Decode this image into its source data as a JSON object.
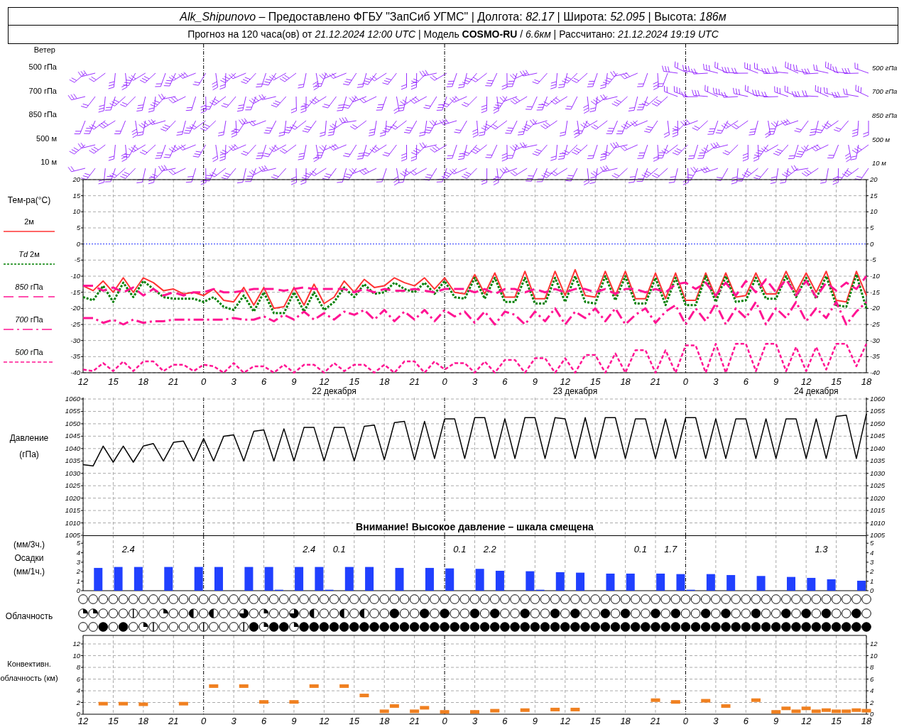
{
  "header": {
    "line_1": "*Alk_Shipunovo* – Предоставлено ФГБУ \"ЗапСиб УГМС\" | Долгота: *82.17* | Широта: *52.095* | Высота: *186м*",
    "line_2": "Прогноз на 120 часа(ов) от *21.12.2024 12:00 UTC*  | Модель **COSMO-RU** / *6.6км* | Рассчитано: *21.12.2024 19:19 UTC*"
  },
  "wind": {
    "title": "Ветер",
    "levels_left": [
      "500 гПа",
      "700 гПа",
      "850 гПа",
      "500 м",
      "10  м"
    ],
    "levels_right": [
      "500 гПа",
      "700 гПа",
      "850 гПа",
      "500 м",
      "10  м"
    ]
  },
  "temperature": {
    "chart_data": {
      "type": "line",
      "ylabel": "Тем-ра(°C)",
      "categories": [
        "12",
        null,
        null,
        "15",
        null,
        null,
        "18",
        null,
        null,
        "21",
        null,
        null,
        "0",
        null,
        null,
        "3",
        null,
        null,
        "6",
        null,
        null,
        "9",
        null,
        null,
        "12",
        null,
        null,
        "15",
        null,
        null,
        "18",
        null,
        null,
        "21",
        null,
        null,
        "0",
        null,
        null,
        "3",
        null,
        null,
        "6",
        null,
        null,
        "9",
        null,
        null,
        "12",
        null,
        null,
        "15",
        null,
        null,
        "18",
        null,
        null,
        "21",
        null,
        null,
        "0",
        null,
        null,
        "3",
        null,
        null,
        "6",
        null,
        null,
        "9",
        null,
        null,
        "12",
        null,
        null,
        "15",
        null,
        null,
        "18"
      ],
      "grid": true,
      "ref_lines": [
        {
          "axis": "y",
          "value": 0,
          "color": "#2030ff"
        }
      ],
      "ylim": [
        -40,
        20
      ],
      "yticks": [
        -40,
        -35,
        -30,
        -25,
        -20,
        -15,
        -10,
        -5,
        0,
        5,
        10,
        15,
        20
      ],
      "series": [
        {
          "name": "2м",
          "color": "#ff3333",
          "line_style": "solid",
          "values": [
            -13,
            -14.5,
            -11.5,
            -15,
            -10.5,
            -15,
            -10.5,
            -12,
            -14.5,
            -14,
            -15.5,
            -15,
            -16,
            -14,
            -17.5,
            -18,
            -13.5,
            -19,
            -13.5,
            -20,
            -19.5,
            -13.5,
            -19,
            -12.5,
            -18.5,
            -16.5,
            -11.5,
            -15,
            -11,
            -13.5,
            -13,
            -10.5,
            -12,
            -13,
            -10.5,
            -14,
            -10.5,
            -15,
            -15.5,
            -9.5,
            -15.5,
            -9,
            -16.5,
            -16.5,
            -8.5,
            -17,
            -17,
            -8.5,
            -16,
            -8,
            -16,
            -16.5,
            -8.5,
            -16,
            -8.5,
            -17,
            -17,
            -9,
            -17,
            -9,
            -17.5,
            -17.5,
            -9,
            -16.5,
            -9,
            -16.5,
            -16,
            -9,
            -15.5,
            -15.5,
            -8.5,
            -15,
            -9,
            -15,
            -8.5,
            -17.5,
            -18,
            -8.5,
            -16
          ]
        },
        {
          "name": "*Td*  2м",
          "color": "#008000",
          "line_style": "dotted",
          "values": [
            -16.5,
            -17.5,
            -13,
            -18,
            -12,
            -16.5,
            -11.5,
            -14,
            -16.5,
            -17,
            -17,
            -17,
            -18,
            -16.5,
            -19.5,
            -20.5,
            -16,
            -21,
            -15,
            -21.5,
            -21.5,
            -15,
            -21,
            -15,
            -20.5,
            -18,
            -13.5,
            -16.5,
            -12.5,
            -15.5,
            -15,
            -12,
            -14,
            -15,
            -12,
            -15.5,
            -11.5,
            -16.5,
            -17,
            -10.5,
            -17,
            -10.5,
            -18,
            -18,
            -10.5,
            -18.5,
            -18.5,
            -10.5,
            -18,
            -10,
            -18,
            -18.5,
            -10,
            -17.5,
            -10,
            -18.5,
            -18.5,
            -10.5,
            -19,
            -10.5,
            -19,
            -19,
            -10,
            -18,
            -10,
            -18,
            -17.5,
            -10.5,
            -17,
            -17,
            -10,
            -16.5,
            -10.5,
            -17,
            -10,
            -19,
            -19.5,
            -9.5,
            -20
          ]
        },
        {
          "name": "*850* гПа",
          "color": "#ff1493",
          "line_style": "long-dashed",
          "values": [
            -13,
            -13,
            -14.5,
            -13.5,
            -15,
            -13.5,
            -16,
            -14,
            -16,
            -15,
            -16,
            -15,
            -15,
            -14,
            -15,
            -15,
            -14.5,
            -14,
            -14,
            -14,
            -14.5,
            -14,
            -13.5,
            -14,
            -14,
            -14,
            -14,
            -15,
            -14,
            -15,
            -14,
            -14.5,
            -14.5,
            -14,
            -14.5,
            -15,
            -14,
            -14,
            -14,
            -15,
            -14,
            -15.5,
            -14,
            -14,
            -15,
            -14,
            -15,
            -14,
            -15,
            -14,
            -14,
            -15,
            -14,
            -15.5,
            -14,
            -14,
            -15,
            -14,
            -15,
            -12.5,
            -12,
            -14,
            -12,
            -16,
            -12,
            -16,
            -11.5,
            -15,
            -11,
            -15,
            -11,
            -16,
            -11.5,
            -16.5,
            -12,
            -14.5,
            -12,
            -14,
            -10
          ]
        },
        {
          "name": "*700* гПа",
          "color": "#ff1493",
          "line_style": "dashdot",
          "values": [
            -23,
            -23,
            -24.5,
            -23.5,
            -25,
            -23.5,
            -24.5,
            -24,
            -24,
            -23.5,
            -23.5,
            -23.5,
            -23.5,
            -23.5,
            -23.5,
            -23,
            -23.5,
            -23.5,
            -22.5,
            -24,
            -22,
            -23.5,
            -21,
            -23.5,
            -21.5,
            -23.5,
            -21,
            -22,
            -20.5,
            -23.5,
            -20.5,
            -24,
            -21,
            -23.5,
            -20.5,
            -24,
            -20.5,
            -22.5,
            -21,
            -24.5,
            -21,
            -25,
            -21,
            -22,
            -25,
            -21,
            -24,
            -20,
            -25,
            -21,
            -23,
            -20,
            -24,
            -20,
            -25,
            -22,
            -20,
            -24.5,
            -21,
            -19,
            -25,
            -20,
            -24,
            -18.5,
            -25,
            -20,
            -23,
            -18,
            -25,
            -20,
            -23,
            -18,
            -24,
            -20,
            -23,
            -18,
            -25,
            -21,
            -18
          ]
        },
        {
          "name": "*500* гПа",
          "color": "#ff1493",
          "line_style": "dashed",
          "values": [
            -39,
            -39.5,
            -37,
            -39.5,
            -36.5,
            -39.5,
            -36.5,
            -36.5,
            -39.5,
            -37.5,
            -37.5,
            -39.5,
            -37.5,
            -38,
            -40,
            -37,
            -40,
            -38,
            -38,
            -40,
            -37.5,
            -40,
            -37.5,
            -37.5,
            -40,
            -37,
            -39.5,
            -37.5,
            -37.5,
            -40,
            -37.5,
            -40,
            -36.5,
            -36.5,
            -40,
            -36.5,
            -39,
            -37,
            -37,
            -40,
            -36.5,
            -40,
            -36,
            -36,
            -40,
            -35.5,
            -35.5,
            -40,
            -35.5,
            -40,
            -34.5,
            -34.5,
            -40,
            -34,
            -40,
            -33,
            -33,
            -40,
            -33,
            -40,
            -31.5,
            -31.5,
            -40,
            -31,
            -40,
            -31,
            -31,
            -39.5,
            -31,
            -31,
            -39.5,
            -32,
            -39.5,
            -32,
            -39,
            -31,
            -31,
            -38,
            -31
          ]
        }
      ]
    },
    "right_ticks": [
      "20",
      "15",
      "10",
      "5",
      "0",
      "-5",
      "-10",
      "-15",
      "-20",
      "-25",
      "-30",
      "-35",
      "-40"
    ],
    "day_labels": [
      "22 декабря",
      "23 декабря",
      "24 декабря"
    ]
  },
  "pressure": {
    "chart_data": {
      "type": "line",
      "ylabel": "Давление (гПа)",
      "grid": true,
      "categories": [
        null,
        null,
        null,
        null,
        null,
        null,
        null,
        null,
        null,
        null,
        null,
        null,
        null,
        null,
        null,
        null,
        null,
        null,
        null,
        null,
        null,
        null,
        null,
        null,
        null,
        null,
        null,
        null,
        null,
        null,
        null,
        null,
        null,
        null,
        null,
        null,
        null,
        null,
        null,
        null,
        null,
        null,
        null,
        null,
        null,
        null,
        null,
        null,
        null,
        null,
        null,
        null,
        null,
        null,
        null,
        null,
        null,
        null,
        null,
        null,
        null,
        null,
        null,
        null,
        null,
        null,
        null,
        null,
        null,
        null,
        null,
        null,
        null,
        null,
        null,
        null,
        null,
        null,
        null
      ],
      "ylim": [
        1005,
        1060
      ],
      "yticks": [
        1005,
        1010,
        1015,
        1020,
        1025,
        1030,
        1035,
        1040,
        1045,
        1050,
        1055,
        1060
      ],
      "series": [
        {
          "color": "#000000",
          "values": [
            1033.5,
            1033,
            1041,
            1034.5,
            1041,
            1034.5,
            1041,
            1042,
            1035,
            1042.5,
            1043,
            1035,
            1044,
            1035,
            1045,
            1045.5,
            1035,
            1047,
            1047.5,
            1035,
            1048,
            1035,
            1048.5,
            1048.5,
            1035,
            1048.5,
            1048.5,
            1035,
            1049,
            1049.5,
            1035.5,
            1050.5,
            1051,
            1035.5,
            1051,
            1036,
            1052,
            1052,
            1036,
            1052.5,
            1052.5,
            1036,
            1052,
            1036,
            1052.5,
            1052.5,
            1036,
            1052.5,
            1052,
            1036,
            1052.5,
            1036,
            1052.5,
            1052.5,
            1036,
            1052,
            1052,
            1036,
            1052,
            1036,
            1052.5,
            1052.5,
            1036,
            1052,
            1036,
            1052,
            1052,
            1036,
            1052,
            1036,
            1052,
            1052,
            1036,
            1052,
            1036,
            1053,
            1053.5,
            1036,
            1054
          ]
        }
      ]
    },
    "right_ticks": [
      "1060",
      "1055",
      "1050",
      "1045",
      "1040",
      "1035",
      "1030",
      "1025",
      "1020",
      "1015",
      "1010",
      "1005"
    ],
    "warning": "Внимание! Высокое давление – шкала смещена"
  },
  "precipitation": {
    "unit_top": "(мм/3ч.)",
    "title": "Осадки",
    "unit_bottom": "(мм/1ч.)",
    "chart_data": {
      "type": "bar",
      "categories": [
        null,
        null,
        null,
        null,
        null,
        null,
        null,
        null,
        null,
        null,
        null,
        null,
        null,
        null,
        null,
        null,
        null,
        null,
        null,
        null,
        null,
        null,
        null,
        null,
        null,
        null,
        null,
        null,
        null,
        null,
        null,
        null,
        null,
        null,
        null,
        null,
        null,
        null,
        null,
        null,
        null,
        null,
        null,
        null,
        null,
        null,
        null,
        null,
        null,
        null,
        null,
        null,
        null,
        null,
        null,
        null,
        null,
        null,
        null,
        null,
        null,
        null,
        null,
        null,
        null,
        null,
        null,
        null,
        null,
        null,
        null,
        null,
        null,
        null,
        null,
        null,
        null,
        null,
        null
      ],
      "grid": "x",
      "ylim": [
        0,
        5.8
      ],
      "yticks": [
        0,
        1,
        2,
        3,
        4,
        5
      ],
      "series": [
        {
          "color": "#2040ff",
          "values": [
            0,
            0,
            2.4,
            0,
            2.5,
            0,
            2.5,
            0,
            0,
            2.5,
            0,
            0,
            2.5,
            0,
            2.5,
            0,
            0,
            2.5,
            0,
            2.5,
            0.1,
            0,
            2.5,
            0,
            2.5,
            0.1,
            0,
            2.5,
            0,
            2.5,
            0,
            0,
            2.4,
            0,
            0,
            2.4,
            0,
            2.35,
            0,
            0,
            2.3,
            0,
            2.1,
            0,
            0,
            2.05,
            0.1,
            0,
            1.95,
            0,
            1.9,
            0,
            0,
            1.8,
            0,
            1.8,
            0,
            0,
            1.8,
            0,
            1.75,
            0.1,
            0,
            1.75,
            0,
            1.65,
            0,
            0,
            1.55,
            0,
            0,
            1.45,
            0,
            1.35,
            0,
            1.2,
            0,
            0,
            1.05
          ]
        }
      ],
      "value_labels": [
        null,
        null,
        null,
        null,
        null,
        "2.4",
        null,
        null,
        null,
        null,
        null,
        null,
        null,
        null,
        null,
        null,
        null,
        null,
        null,
        null,
        null,
        null,
        null,
        "2.4",
        null,
        null,
        "0.1",
        null,
        null,
        null,
        null,
        null,
        null,
        null,
        null,
        null,
        null,
        null,
        "0.1",
        null,
        null,
        "2.2",
        null,
        null,
        null,
        null,
        null,
        null,
        null,
        null,
        null,
        null,
        null,
        null,
        null,
        null,
        "0.1",
        null,
        null,
        "1.7",
        null,
        null,
        null,
        null,
        null,
        null,
        null,
        null,
        null,
        null,
        null,
        null,
        null,
        null,
        "1.3",
        null,
        null,
        null,
        null
      ]
    },
    "right_ticks": [
      "5",
      "4",
      "3",
      "2",
      "1",
      "0"
    ]
  },
  "cloudiness": {
    "title": "Облачность",
    "rows": [
      {
        "cells": [
          {
            "kind": "clear"
          },
          {
            "kind": "clear"
          },
          {
            "kind": "clear"
          },
          {
            "kind": "clear"
          },
          {
            "kind": "clear"
          },
          {
            "kind": "clear"
          },
          {
            "kind": "clear"
          },
          {
            "kind": "clear"
          },
          {
            "kind": "clear"
          },
          {
            "kind": "clear"
          },
          {
            "kind": "clear"
          },
          {
            "kind": "clear"
          },
          {
            "kind": "clear"
          },
          {
            "kind": "clear"
          },
          {
            "kind": "clear"
          },
          {
            "kind": "clear"
          },
          {
            "kind": "clear"
          },
          {
            "kind": "clear"
          },
          {
            "kind": "clear"
          },
          {
            "kind": "clear"
          },
          {
            "kind": "clear"
          },
          {
            "kind": "clear"
          },
          {
            "kind": "clear"
          },
          {
            "kind": "clear"
          },
          {
            "kind": "clear"
          },
          {
            "kind": "clear"
          },
          {
            "kind": "clear"
          },
          {
            "kind": "clear"
          },
          {
            "kind": "clear"
          },
          {
            "kind": "clear"
          },
          {
            "kind": "clear"
          },
          {
            "kind": "clear"
          },
          {
            "kind": "clear"
          },
          {
            "kind": "clear"
          },
          {
            "kind": "clear"
          },
          {
            "kind": "clear"
          },
          {
            "kind": "clear"
          },
          {
            "kind": "clear"
          },
          {
            "kind": "clear"
          },
          {
            "kind": "clear"
          },
          {
            "kind": "clear"
          },
          {
            "kind": "clear"
          },
          {
            "kind": "clear"
          },
          {
            "kind": "clear"
          },
          {
            "kind": "clear"
          },
          {
            "kind": "clear"
          },
          {
            "kind": "clear"
          },
          {
            "kind": "clear"
          },
          {
            "kind": "clear"
          },
          {
            "kind": "clear"
          },
          {
            "kind": "clear"
          },
          {
            "kind": "clear"
          },
          {
            "kind": "clear"
          },
          {
            "kind": "clear"
          },
          {
            "kind": "clear"
          },
          {
            "kind": "clear"
          },
          {
            "kind": "clear"
          },
          {
            "kind": "clear"
          },
          {
            "kind": "clear"
          },
          {
            "kind": "clear"
          },
          {
            "kind": "clear"
          },
          {
            "kind": "clear"
          },
          {
            "kind": "clear"
          },
          {
            "kind": "clear"
          },
          {
            "kind": "clear"
          },
          {
            "kind": "clear"
          },
          {
            "kind": "clear"
          },
          {
            "kind": "clear"
          },
          {
            "kind": "clear"
          },
          {
            "kind": "clear"
          },
          {
            "kind": "clear"
          },
          {
            "kind": "clear"
          },
          {
            "kind": "clear"
          },
          {
            "kind": "clear"
          },
          {
            "kind": "clear"
          },
          {
            "kind": "clear"
          },
          {
            "kind": "clear"
          },
          {
            "kind": "clear"
          },
          {
            "kind": "clear"
          }
        ]
      },
      {
        "cells": [
          {
            "kind": "quarter"
          },
          {
            "kind": "quarter"
          },
          {
            "kind": "clear"
          },
          {
            "kind": "clear"
          },
          {
            "kind": "clear"
          },
          {
            "kind": "line"
          },
          {
            "kind": "clear"
          },
          {
            "kind": "clear"
          },
          {
            "kind": "quarter"
          },
          {
            "kind": "clear"
          },
          {
            "kind": "clear"
          },
          {
            "kind": "half"
          },
          {
            "kind": "clear"
          },
          {
            "kind": "half"
          },
          {
            "kind": "clear"
          },
          {
            "kind": "clear"
          },
          {
            "kind": "three-quarters"
          },
          {
            "kind": "clear"
          },
          {
            "kind": "quarter"
          },
          {
            "kind": "clear"
          },
          {
            "kind": "clear"
          },
          {
            "kind": "three-quarters"
          },
          {
            "kind": "clear"
          },
          {
            "kind": "half"
          },
          {
            "kind": "clear"
          },
          {
            "kind": "clear"
          },
          {
            "kind": "half"
          },
          {
            "kind": "clear"
          },
          {
            "kind": "half"
          },
          {
            "kind": "clear"
          },
          {
            "kind": "clear"
          },
          {
            "kind": "overcast"
          },
          {
            "kind": "clear"
          },
          {
            "kind": "clear"
          },
          {
            "kind": "overcast"
          },
          {
            "kind": "clear"
          },
          {
            "kind": "overcast"
          },
          {
            "kind": "clear"
          },
          {
            "kind": "clear"
          },
          {
            "kind": "overcast"
          },
          {
            "kind": "clear"
          },
          {
            "kind": "overcast"
          },
          {
            "kind": "clear"
          },
          {
            "kind": "clear"
          },
          {
            "kind": "overcast"
          },
          {
            "kind": "clear"
          },
          {
            "kind": "clear"
          },
          {
            "kind": "overcast"
          },
          {
            "kind": "clear"
          },
          {
            "kind": "overcast"
          },
          {
            "kind": "clear"
          },
          {
            "kind": "clear"
          },
          {
            "kind": "overcast"
          },
          {
            "kind": "clear"
          },
          {
            "kind": "overcast"
          },
          {
            "kind": "clear"
          },
          {
            "kind": "clear"
          },
          {
            "kind": "overcast"
          },
          {
            "kind": "clear"
          },
          {
            "kind": "overcast"
          },
          {
            "kind": "clear"
          },
          {
            "kind": "clear"
          },
          {
            "kind": "overcast"
          },
          {
            "kind": "clear"
          },
          {
            "kind": "overcast"
          },
          {
            "kind": "clear"
          },
          {
            "kind": "clear"
          },
          {
            "kind": "overcast"
          },
          {
            "kind": "clear"
          },
          {
            "kind": "clear"
          },
          {
            "kind": "overcast"
          },
          {
            "kind": "clear"
          },
          {
            "kind": "overcast"
          },
          {
            "kind": "clear"
          },
          {
            "kind": "overcast"
          },
          {
            "kind": "clear"
          },
          {
            "kind": "clear"
          },
          {
            "kind": "overcast"
          },
          {
            "kind": "clear"
          }
        ]
      },
      {
        "cells": [
          {
            "kind": "clear"
          },
          {
            "kind": "clear"
          },
          {
            "kind": "overcast"
          },
          {
            "kind": "clear"
          },
          {
            "kind": "overcast"
          },
          {
            "kind": "clear"
          },
          {
            "kind": "quarter"
          },
          {
            "kind": "line"
          },
          {
            "kind": "clear"
          },
          {
            "kind": "clear"
          },
          {
            "kind": "clear"
          },
          {
            "kind": "clear"
          },
          {
            "kind": "line"
          },
          {
            "kind": "clear"
          },
          {
            "kind": "clear"
          },
          {
            "kind": "clear"
          },
          {
            "kind": "line"
          },
          {
            "kind": "overcast"
          },
          {
            "kind": "quarter"
          },
          {
            "kind": "overcast"
          },
          {
            "kind": "overcast"
          },
          {
            "kind": "quarter"
          },
          {
            "kind": "overcast"
          },
          {
            "kind": "overcast"
          },
          {
            "kind": "overcast"
          },
          {
            "kind": "overcast"
          },
          {
            "kind": "overcast"
          },
          {
            "kind": "overcast"
          },
          {
            "kind": "overcast"
          },
          {
            "kind": "overcast"
          },
          {
            "kind": "overcast"
          },
          {
            "kind": "overcast"
          },
          {
            "kind": "overcast"
          },
          {
            "kind": "overcast"
          },
          {
            "kind": "overcast"
          },
          {
            "kind": "overcast"
          },
          {
            "kind": "overcast"
          },
          {
            "kind": "overcast"
          },
          {
            "kind": "overcast"
          },
          {
            "kind": "overcast"
          },
          {
            "kind": "overcast"
          },
          {
            "kind": "overcast"
          },
          {
            "kind": "overcast"
          },
          {
            "kind": "overcast"
          },
          {
            "kind": "overcast"
          },
          {
            "kind": "overcast"
          },
          {
            "kind": "overcast"
          },
          {
            "kind": "overcast"
          },
          {
            "kind": "overcast"
          },
          {
            "kind": "overcast"
          },
          {
            "kind": "overcast"
          },
          {
            "kind": "overcast"
          },
          {
            "kind": "overcast"
          },
          {
            "kind": "overcast"
          },
          {
            "kind": "overcast"
          },
          {
            "kind": "overcast"
          },
          {
            "kind": "overcast"
          },
          {
            "kind": "overcast"
          },
          {
            "kind": "overcast"
          },
          {
            "kind": "overcast"
          },
          {
            "kind": "overcast"
          },
          {
            "kind": "overcast"
          },
          {
            "kind": "overcast"
          },
          {
            "kind": "overcast"
          },
          {
            "kind": "overcast"
          },
          {
            "kind": "overcast"
          },
          {
            "kind": "overcast"
          },
          {
            "kind": "overcast"
          },
          {
            "kind": "overcast"
          },
          {
            "kind": "overcast"
          },
          {
            "kind": "overcast"
          },
          {
            "kind": "overcast"
          },
          {
            "kind": "overcast"
          },
          {
            "kind": "overcast"
          },
          {
            "kind": "overcast"
          },
          {
            "kind": "overcast"
          },
          {
            "kind": "overcast"
          },
          {
            "kind": "overcast"
          },
          {
            "kind": "overcast"
          }
        ]
      }
    ]
  },
  "convective": {
    "chart_data": {
      "type": "scatter",
      "ylabel": "Конвективн. облачность (км)",
      "categories": [
        "12",
        null,
        null,
        "15",
        null,
        null,
        "18",
        null,
        null,
        "21",
        null,
        null,
        "0",
        null,
        null,
        "3",
        null,
        null,
        "6",
        null,
        null,
        "9",
        null,
        null,
        "12",
        null,
        null,
        "15",
        null,
        null,
        "18",
        null,
        null,
        "21",
        null,
        null,
        "0",
        null,
        null,
        "3",
        null,
        null,
        "6",
        null,
        null,
        "9",
        null,
        null,
        "12",
        null,
        null,
        "15",
        null,
        null,
        "18",
        null,
        null,
        "21",
        null,
        null,
        "0",
        null,
        null,
        "3",
        null,
        null,
        "6",
        null,
        null,
        "9",
        null,
        null,
        "12",
        null,
        null,
        "15",
        null,
        null,
        "18"
      ],
      "grid": true,
      "ylim": [
        0,
        12
      ],
      "yticks": [
        0,
        2,
        4,
        6,
        8,
        10,
        12
      ],
      "series": [
        {
          "color": "#f08020",
          "values": [
            null,
            null,
            1.8,
            null,
            1.8,
            null,
            1.7,
            null,
            null,
            null,
            1.8,
            null,
            null,
            4.8,
            null,
            null,
            4.8,
            null,
            2.1,
            null,
            null,
            2.1,
            null,
            4.8,
            null,
            null,
            4.8,
            null,
            3.2,
            null,
            0.5,
            1.4,
            null,
            0.5,
            1.1,
            null,
            0.4,
            null,
            null,
            0.4,
            null,
            0.6,
            null,
            null,
            0.7,
            null,
            null,
            0.8,
            null,
            0.8,
            null,
            null,
            null,
            null,
            null,
            null,
            null,
            2.4,
            null,
            2.1,
            null,
            null,
            2.3,
            null,
            1.4,
            null,
            null,
            2.4,
            null,
            0.4,
            1.0,
            0.5,
            1.0,
            0.5,
            0.7,
            0.5,
            0.5,
            0.7,
            0.6
          ]
        }
      ]
    },
    "right_ticks": [
      "12",
      "10",
      "8",
      "6",
      "4",
      "2",
      "0"
    ]
  }
}
